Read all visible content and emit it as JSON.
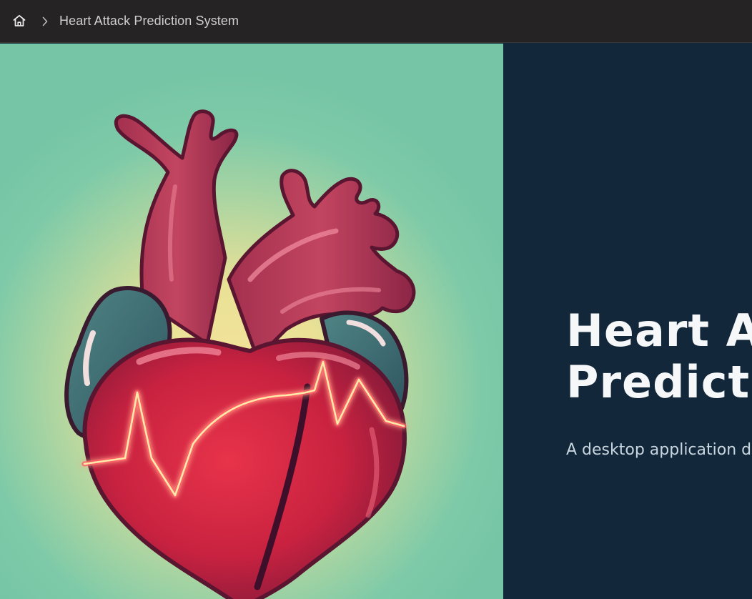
{
  "topbar": {
    "home_icon": "home-icon",
    "separator_icon": "chevron-right-icon",
    "breadcrumb_label": "Heart Attack Prediction System"
  },
  "hero": {
    "image_subject": "heart-illustration",
    "title": "Heart Attack Prediction System",
    "subtitle": "A desktop application designed to predict the risk of heart attack"
  },
  "colors": {
    "topbar_bg": "#252323",
    "content_bg": "#12283a",
    "heart_red": "#d8293d",
    "heart_teal": "#3f6e72",
    "ecg_line": "#ffe9a6",
    "bg_mint": "#75c5a6",
    "bg_glow": "#f6e49a"
  }
}
